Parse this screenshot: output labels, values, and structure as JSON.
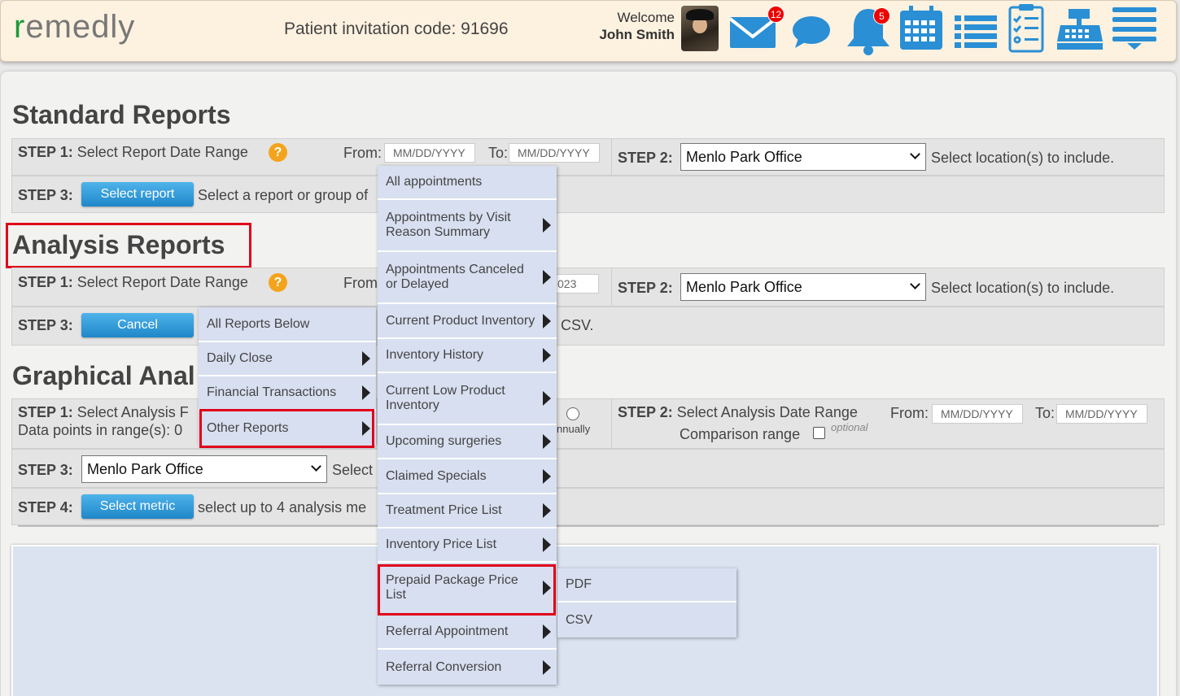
{
  "header": {
    "logo": "remedly",
    "invitation": "Patient invitation code: 91696",
    "welcome_label": "Welcome",
    "user_name": "John Smith",
    "mail_badge": "12",
    "bell_badge": "5"
  },
  "standard": {
    "title": "Standard Reports",
    "step1_label": "STEP 1:",
    "step1_text": "Select Report Date Range",
    "from_label": "From:",
    "to_label": "To:",
    "date_placeholder": "MM/DD/YYYY",
    "step2_label": "STEP 2:",
    "location": "Menlo Park Office",
    "step2_hint": "Select location(s) to include.",
    "step3_label": "STEP 3:",
    "step3_button": "Select report",
    "step3_text": "Select a report or group of"
  },
  "analysis": {
    "title": "Analysis Reports",
    "step1_label": "STEP 1:",
    "step1_text": "Select Report Date Range",
    "from_label": "From",
    "to_value_partial": "023",
    "step2_label": "STEP 2:",
    "location": "Menlo Park Office",
    "step2_hint": "Select location(s) to include.",
    "step3_label": "STEP 3:",
    "step3_button": "Cancel",
    "step3_tail": "CSV."
  },
  "graphical": {
    "title": "Graphical Anal",
    "step1_label": "STEP 1:",
    "step1_text": "Select Analysis F",
    "data_points": "Data points in range(s): 0",
    "annually": "nnually",
    "step2_label": "STEP 2:",
    "step2_text": "Select Analysis Date Range",
    "from_label": "From:",
    "to_label": "To:",
    "comparison": "Comparison range",
    "optional": "optional",
    "step3_label": "STEP 3:",
    "location": "Menlo Park Office",
    "step3_text": "Select",
    "step4_label": "STEP 4:",
    "step4_button": "Select metric",
    "step4_text": "select up to 4 analysis me"
  },
  "menu1": [
    "All Reports Below",
    "Daily Close",
    "Financial Transactions",
    "Other Reports"
  ],
  "menu2": [
    "All appointments",
    "Appointments by Visit Reason Summary",
    "Appointments Canceled or Delayed",
    "Current Product Inventory",
    "Inventory History",
    "Current Low Product Inventory",
    "Upcoming surgeries",
    "Claimed Specials",
    "Treatment Price List",
    "Inventory Price List",
    "Prepaid Package Price List",
    "Referral Appointment",
    "Referral Conversion"
  ],
  "menu3": [
    "PDF",
    "CSV"
  ],
  "icons": [
    "mail-icon",
    "chat-icon",
    "bell-icon",
    "calendar-icon",
    "list-icon",
    "checklist-icon",
    "cash-register-icon",
    "hamburger-menu-icon"
  ],
  "colors": {
    "accent": "#2a8fd4",
    "highlight": "#e0001b",
    "badge": "#ee0000"
  }
}
